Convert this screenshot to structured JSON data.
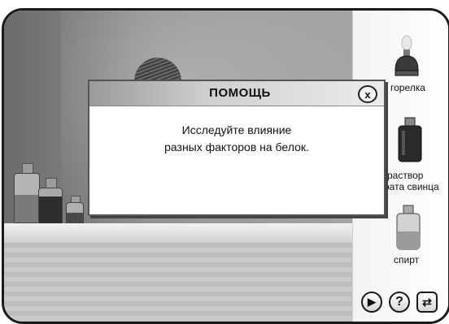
{
  "dialog": {
    "title": "ПОМОЩЬ",
    "close_label": "x",
    "message_line1": "Исследуйте влияние",
    "message_line2": "разных факторов на белок."
  },
  "reagents": [
    {
      "label": "горелка",
      "icon": "burner-lamp-icon"
    },
    {
      "label_line1": "раствор",
      "label_line2": "рата свинца",
      "icon": "lead-solution-bottle-icon"
    },
    {
      "label": "спирт",
      "icon": "alcohol-bottle-icon"
    }
  ],
  "controls": {
    "play": "▶",
    "help": "?",
    "refresh": "⇄"
  }
}
